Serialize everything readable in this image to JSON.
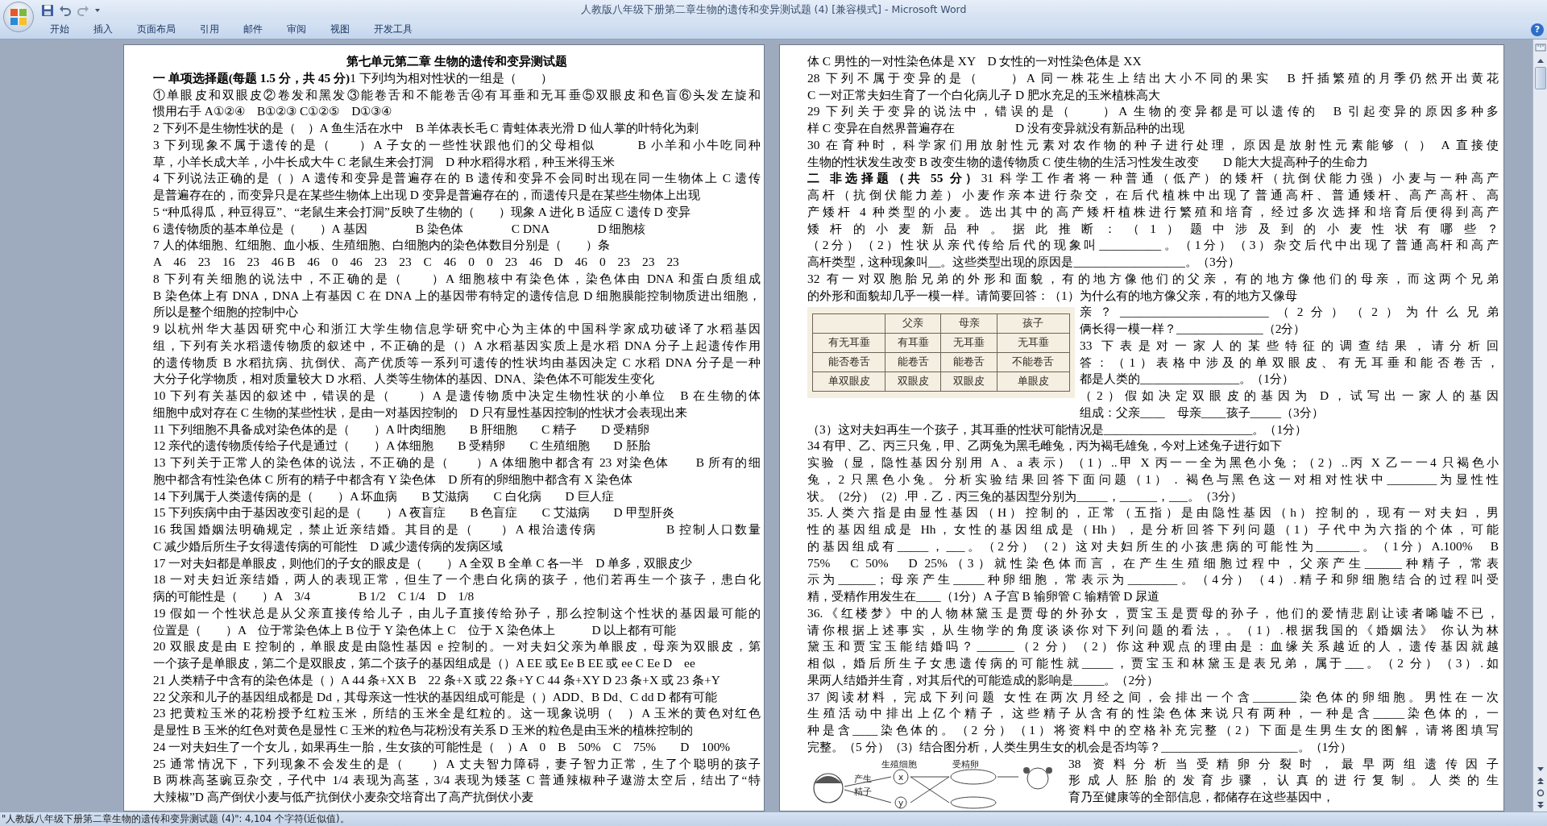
{
  "window": {
    "title": "人教版八年级下册第二章生物的遗传和变异测试题 (4) [兼容模式] - Microsoft Word"
  },
  "ribbon_tabs": [
    {
      "label": "开始",
      "selected": false
    },
    {
      "label": "插入",
      "selected": false
    },
    {
      "label": "页面布局",
      "selected": false
    },
    {
      "label": "引用",
      "selected": false
    },
    {
      "label": "邮件",
      "selected": false
    },
    {
      "label": "审阅",
      "selected": false
    },
    {
      "label": "视图",
      "selected": false
    },
    {
      "label": "开发工具",
      "selected": false
    }
  ],
  "help_button": "?",
  "pages": [
    {
      "blocks": [
        {
          "kind": "title",
          "text": "第七单元第二章 生物的遗传和变异测试题"
        },
        {
          "kind": "para",
          "lines": [
            "**一 单项选择题(每题 1.5 分，共 45 分)**1 下列均为相对性状的一组是（　　）"
          ]
        },
        {
          "kind": "para",
          "lines": [
            "①单眼皮和双眼皮②卷发和黑发③能卷舌和不能卷舌④有耳垂和无耳垂⑤双眼皮和色盲⑥头发左旋和",
            "惯用右手 A①②④　B①②③ C①②⑤　D①③④"
          ]
        },
        {
          "kind": "para",
          "lines": [
            "2 下列不是生物性状的是（　）A 鱼生活在水中　B 羊体表长毛 C 青蛙体表光滑 D 仙人掌的叶特化为刺"
          ]
        },
        {
          "kind": "para",
          "lines": [
            "3 下列现象不属于遗传的是（　　）A 子女的一些性状跟他们的父母相似　　　B 小羊和小牛吃同种",
            "草，小羊长成大羊，小牛长成大牛 C 老鼠生来会打洞　D 种水稻得水稻，种玉米得玉米"
          ]
        },
        {
          "kind": "para",
          "lines": [
            "4 下列说法正确的是（ ）A 遗传和变异是普遍存在的 B 遗传和变异不会同时出现在同一生物体上 C 遗传",
            "是普遍存在的，而变异只是在某些生物体上出现 D 变异是普遍存在的，而遗传只是在某些生物体上出现"
          ]
        },
        {
          "kind": "para",
          "lines": [
            "5 “种瓜得瓜，种豆得豆”、“老鼠生来会打洞”反映了生物的（　　）现象 A 进化 B 适应 C 遗传 D 变异"
          ]
        },
        {
          "kind": "para",
          "lines": [
            "6 遗传物质的基本单位是（　　）A 基因　　　　B 染色体　　　　C DNA　　　　D 细胞核"
          ]
        },
        {
          "kind": "para",
          "lines": [
            "7 人的体细胞、红细胞、血小板、生殖细胞、白细胞内的染色体数目分别是（　　）条"
          ]
        },
        {
          "kind": "para",
          "lines": [
            "A　46　23　16　23　46 B　46　0　46　23　23　C　46　0　0　23　46　D　46　0　23　23　23"
          ]
        },
        {
          "kind": "para",
          "lines": [
            "8 下列有关细胞的说法中，不正确的是（　　）A 细胞核中有染色体，染色体由 DNA 和蛋白质组成",
            "B 染色体上有 DNA，DNA 上有基因 C 在 DNA 上的基因带有特定的遗传信息 D 细胞膜能控制物质进出细胞，",
            "所以是整个细胞的控制中心"
          ]
        },
        {
          "kind": "para",
          "lines": [
            "9 以杭州华大基因研究中心和浙江大学生物信息学研究中心为主体的中国科学家成功破译了水稻基因",
            "组，下列有关水稻遗传物质的叙述中，不正确的是（）A 水稻基因实质上是水稻 DNA 分子上起遗传作用",
            "的遗传物质 B 水稻抗病、抗倒伏、高产优质等一系列可遗传的性状均由基因决定 C 水稻 DNA 分子是一种",
            "大分子化学物质，相对质量较大 D 水稻、人类等生物体的基因、DNA、染色体不可能发生变化"
          ]
        },
        {
          "kind": "para",
          "lines": [
            "10 下列有关基因的叙述中，错误的是（　　）A 是遗传物质中决定生物性状的小单位　B 在生物的体",
            "细胞中成对存在 C 生物的某些性状，是由一对基因控制的　D 只有显性基因控制的性状才会表现出来"
          ]
        },
        {
          "kind": "para",
          "lines": [
            "11 下列细胞不具备成对染色体的是（　　）A 叶肉细胞　　B 肝细胞　　C 精子　　D 受精卵"
          ]
        },
        {
          "kind": "para",
          "lines": [
            "12 亲代的遗传物质传给子代是通过（　　）A 体细胞　　B 受精卵　　C 生殖细胞　　D 胚胎"
          ]
        },
        {
          "kind": "para",
          "lines": [
            "13 下列关于正常人的染色体的说法，不正确的是（　　）A 体细胞中都含有 23 对染色体　　B 所有的细",
            "胞中都含有性染色体 C 所有的精子中都含有 Y 染色体　D 所有的卵细胞中都含有 X 染色体"
          ]
        },
        {
          "kind": "para",
          "lines": [
            "14 下列属于人类遗传病的是（　　）A 坏血病　　B 艾滋病　　C 白化病　　D 巨人症"
          ]
        },
        {
          "kind": "para",
          "lines": [
            "15 下列疾病中由于基因改变引起的是（　　）A 夜盲症　　B 色盲症　　C 艾滋病　　D 甲型肝炎"
          ]
        },
        {
          "kind": "para",
          "lines": [
            "16 我国婚姻法明确规定，禁止近亲结婚。其目的是（　　）A 根治遗传病　　　　　B 控制人口数量",
            "C 减少婚后所生子女得遗传病的可能性　D 减少遗传病的发病区域"
          ]
        },
        {
          "kind": "para",
          "lines": [
            "17 一对夫妇都是单眼皮，则他们的子女的眼皮是（　　）A 全双 B 全单 C 各一半　D 单多，双眼皮少"
          ]
        },
        {
          "kind": "para",
          "lines": [
            "18 一对夫妇近亲结婚，两人的表现正常，但生了一个患白化病的孩子，他们若再生一个孩子，患白化",
            "病的可能性是（　　）A　3/4　　　　B 1/2　C 1/4　D　1/8"
          ]
        },
        {
          "kind": "para",
          "lines": [
            "19 假如一个性状总是从父亲直接传给儿子，由儿子直接传给孙子，那么控制这个性状的基因最可能的",
            "位置是（　　）A　位于常染色体上 B 位于 Y 染色体上 C　位于 X 染色体上　　　D 以上都有可能"
          ]
        },
        {
          "kind": "para",
          "lines": [
            "20 双眼皮是由 E 控制的，单眼皮是由隐性基因 e 控制的。一对夫妇父亲为单眼皮，母亲为双眼皮，第",
            "一个孩子是单眼皮，第二个是双眼皮，第二个孩子的基因组成是（）A EE 或 Ee B EE 或 ee C Ee D　ee"
          ]
        },
        {
          "kind": "para",
          "lines": [
            "21 人类精子中含有的染色体是（ ）A 44 条+XX B　22 条+X 或 22 条+Y C 44 条+XY D 23 条+X 或 23 条+Y"
          ]
        },
        {
          "kind": "para",
          "lines": [
            "22 父亲和儿子的基因组成都是 Dd，其母亲这一性状的基因组成可能是（ ）ADD、B Dd、C dd D 都有可能"
          ]
        },
        {
          "kind": "para",
          "lines": [
            "23 把黄粒玉米的花粉授予红粒玉米，所结的玉米全是红粒的。这一现象说明（　）A 玉米的黄色对红色",
            "是显性 B 玉米的红色对黄色是显性 C 玉米的粒色与花粉没有关系 D 玉米的粒色是由玉米的植株控制的"
          ]
        },
        {
          "kind": "para",
          "lines": [
            "24 一对夫妇生了一个女儿，如果再生一胎，生女孩的可能性是（　）A　0　B　50%　C　75%　　D　100%"
          ]
        },
        {
          "kind": "para",
          "lines": [
            "25 通常情况下，下列现象不会发生的是（　　）A 丈夫智力障碍，妻子智力正常，生了个聪明的孩子",
            "B 两株高茎豌豆杂交，子代中 1/4 表现为高茎，3/4 表现为矮茎 C 普通辣椒种子遨游太空后，结出了“特",
            "大辣椒”D 高产倒伏小麦与低产抗倒伏小麦杂交培育出了高产抗倒伏小麦"
          ]
        }
      ]
    },
    {
      "blocks": [
        {
          "kind": "para",
          "lines": [
            "体 C 男性的一对性染色体是 XY　D 女性的一对性染色体是 XX"
          ]
        },
        {
          "kind": "para",
          "lines": [
            "28 下列不属于变异的是（　　）A 同一株花生上结出大小不同的果实　B 扦插繁殖的月季仍然开出黄花",
            "C 一对正常夫妇生育了一个白化病儿子 D 肥水充足的玉米植株高大"
          ]
        },
        {
          "kind": "para",
          "lines": [
            "29 下列关于变异的说法中，错误的是（　　）A 生物的变异都是可以遗传的　B 引起变异的原因多种多",
            "样 C 变异在自然界普遍存在　　　　　D 没有变异就没有新品种的出现"
          ]
        },
        {
          "kind": "para",
          "lines": [
            "30 在育种时，科学家们用放射性元素对农作物的种子进行处理，原因是放射性元素能够（ ） A 直接使",
            "生物的性状发生改变 B 改变生物的遗传物质 C 使生物的生活习性发生改变　　D 能大大提高种子的生命力"
          ]
        },
        {
          "kind": "para",
          "lines": [
            "**二 非选择题（共 55 分）**31 科学工作者将一种普通（低产）的矮杆（抗倒伏能力强）小麦与一种高产",
            "高杆（抗倒伏能力差）小麦作亲本进行杂交，在后代植株中出现了普通高杆、普通矮杆、高产高杆、高",
            "产矮杆 4 种类型的小麦。选出其中的高产矮杆植株进行繁殖和培育，经过多次选择和培育后便得到高产",
            "矮杆的小麦新品种。据此推断：（1）题中涉及到的小麦性状有哪些？",
            "（2分）（2）性状从亲代传给后代的现象叫__________。（1分）（3）杂交后代中出现了普通高杆和高产",
            "高杆类型，这种现象叫__。这些类型出现的原因是__________________。（3分）"
          ]
        },
        {
          "kind": "para",
          "lines": [
            "32 有一对双胞胎兄弟的外形和面貌，有的地方像他们的父亲，有的地方像他们的母亲，而这两个兄弟",
            "的外形和面貌却几乎一模一样。请简要回答：（1）为什么有的地方像父亲，有的地方又像母"
          ]
        },
        {
          "kind": "table_float",
          "table": {
            "columns": [
              "",
              "父亲",
              "母亲",
              "孩子"
            ],
            "rows": [
              [
                "有无耳垂",
                "有耳垂",
                "无耳垂",
                "无耳垂"
              ],
              [
                "能否卷舌",
                "能卷舌",
                "能卷舌",
                "不能卷舌"
              ],
              [
                "单双眼皮",
                "双眼皮",
                "双眼皮",
                "单眼皮"
              ]
            ]
          },
          "paragraphs": [
            [
              "亲？________________________（2分）（2）为什么兄弟",
              "俩长得一模一样？______________（2分）"
            ],
            [
              "33 下表是对一家人的某些特征的调查结果，请分析回",
              "答：（1）表格中涉及的单双眼皮、有无耳垂和能否卷舌，",
              "都是人类的________________。（1分）"
            ],
            [
              "（2）假如决定双眼皮的基因为 D，试写出一家人的基因",
              "组成：父亲____　母亲____孩子_____（3分）"
            ]
          ]
        },
        {
          "kind": "para",
          "lines": [
            "（3）这对夫妇再生一个孩子，其耳垂的性状可能情况是________________________。（1分）"
          ]
        },
        {
          "kind": "para",
          "lines": [
            "34 有甲、乙、丙三只兔，甲、乙两兔为黑毛雌兔，丙为褐毛雄兔，今对上述兔子进行如下"
          ]
        },
        {
          "kind": "para",
          "lines": [
            "实验（显，隐性基因分别用 A、a 表示）（1）..甲 X 丙一一全为黑色小兔；（2）..丙 X 乙一一4 只褐色小",
            "兔，2 只黑色小兔。分析实验结果回答下面问题（1）．褐色与黑色这一对相对性状中________为显性性",
            "状。（2分）（2）.甲．乙．丙三兔的基因型分别为_____，______，___。（3分）"
          ]
        },
        {
          "kind": "para",
          "lines": [
            "35.人类六指是由显性基因（H）控制的，正常（五指）是由隐性基因（h）控制的，现有一对夫妇，男",
            "性的基因组成是 Hh，女性的基因组成是（Hh），是分析回答下列问题（1）子代中为六指的个体，可能",
            "的基因组成有_____，___。（2分）（2）这对夫妇所生的小孩患病的可能性为_______。（1分）A.100%　B",
            "75%　C 50%　D 25%（3）就性染色体而言，在产生生殖细胞过程中，父亲产生______种精子，常表",
            "示为______；母亲产生_____种卵细胞，常表示为________。（4分）（4）.精子和卵细胞结合的过程叫受",
            "精，受精作用发生在____（1分）A 子宫 B 输卵管 C 输精管 D 尿道"
          ]
        },
        {
          "kind": "para",
          "lines": [
            "36.《红楼梦》中的人物林黛玉是贾母的外孙女，贾宝玉是贾母的孙子，他们的爱情悲剧让读者唏嘘不已，",
            "请你根据上述事实，从生物学的角度谈谈你对下列问题的看法，。（1）.根据我国的《婚姻法》 你认为林",
            "黛玉和贾宝玉能结婚吗？______（2 分）（2）你这种观点的理由是：血缘关系越近的人，遗传基因就越",
            "相似，婚后所生子女患遗传病的可能性就_____，贾宝玉和林黛玉是表兄弟，属于___。（2 分）（3）.如",
            "果两人结婚并生育，对其后代的可能造成的影响是_____。（2分）"
          ]
        },
        {
          "kind": "para",
          "lines": [
            "37 阅读材料，完成下列问题 女性在两次月经之间，会排出一个含_______染色体的卵细胞。男性在一次",
            "生殖活动中排出上亿个精子，这些精子从含有的性染色体来说只有两种，一种是含_____染色体的，一",
            "种是含____染色体的。（2 分）（1）将资料中的空格补充完整（2）下面是生男生女的图解，请将图填写",
            "完整。（5 分）（3）结合图分析，人类生男生女的机会是否均等？______________________。（1分）"
          ]
        },
        {
          "kind": "figure_float",
          "figure": {
            "column_labels": [
              "生殖细胞",
              "受精卵"
            ],
            "arrow_label": [
              "产生",
              "精子"
            ],
            "cells": [
              "x",
              "y"
            ]
          },
          "paragraphs": [
            [
              "38 资料分析当受精卵分裂时，最早两组遗传因子",
              "形成人胚胎的发育步骤，认真的进行复制。人类的生",
              "育乃至健康等的全部信息，都储存在这些基因中，"
            ]
          ]
        }
      ]
    }
  ],
  "status_bar": {
    "text": "\"人教版八年级下册第二章生物的遗传和变异测试题 (4)\": 4,104 个字符(近似值)。"
  }
}
